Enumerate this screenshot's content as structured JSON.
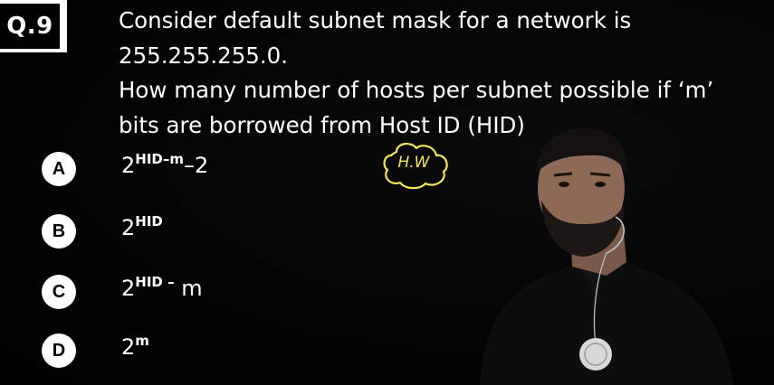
{
  "question": {
    "number": "Q.9",
    "lines": [
      "Consider default subnet mask for a network is",
      "255.255.255.0.",
      "How many number of hosts per subnet possible if ‘m’",
      "bits are borrowed from Host ID (HID)"
    ]
  },
  "options": [
    {
      "letter": "A",
      "base": "2",
      "exponent": "HID–m",
      "suffix": "–2"
    },
    {
      "letter": "B",
      "base": "2",
      "exponent": "HID",
      "suffix": ""
    },
    {
      "letter": "C",
      "base": "2",
      "exponent": "HID –",
      "suffix": " m"
    },
    {
      "letter": "D",
      "base": "2",
      "exponent": "m",
      "suffix": ""
    }
  ],
  "annotation": {
    "text": "H.W",
    "color": "#f3e65a"
  },
  "colors": {
    "background": "#000000",
    "text": "#ffffff",
    "option_circle": "#ffffff"
  }
}
